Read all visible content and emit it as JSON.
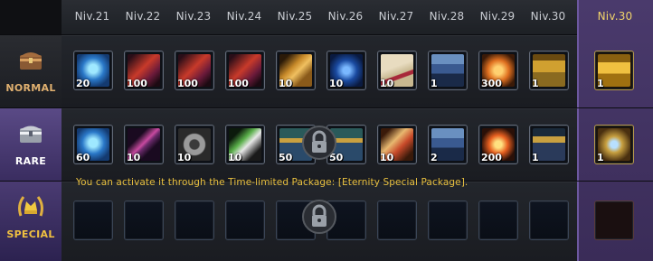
{
  "header": {
    "levels": [
      "Niv.21",
      "Niv.22",
      "Niv.23",
      "Niv.24",
      "Niv.25",
      "Niv.26",
      "Niv.27",
      "Niv.28",
      "Niv.29",
      "Niv.30"
    ],
    "final_level": "Niv.30"
  },
  "rows": {
    "normal": {
      "label": "NORMAL",
      "quantities": [
        "20",
        "100",
        "100",
        "100",
        "10",
        "10",
        "10",
        "1",
        "300",
        "1"
      ],
      "final_quantity": "1"
    },
    "rare": {
      "label": "RARE",
      "quantities": [
        "60",
        "10",
        "10",
        "10",
        "50",
        "50",
        "10",
        "2",
        "200",
        "1"
      ],
      "final_quantity": "1"
    },
    "special": {
      "label": "SPECIAL",
      "notice": "You can activate it through the Time-limited Package: [Eternity Special Package]."
    }
  },
  "icons": {
    "normal": [
      "blue-gem-icon",
      "red-feather-icon",
      "red-feather-icon",
      "red-feather-icon",
      "golden-scroll-icon",
      "blue-magic-circle-icon",
      "sealed-letter-icon",
      "silver-chest-icon",
      "orange-gem-icon",
      "golden-chest-icon"
    ],
    "rare": [
      "blue-gem-icon",
      "magic-staff-icon",
      "gears-icon",
      "green-capsule-icon",
      "ornate-capsule-icon",
      "ornate-capsule-icon",
      "parchment-scroll-icon",
      "silver-chest-icon",
      "fire-orb-icon",
      "ornate-chest-icon"
    ],
    "final_normal": "golden-treasure-chest-icon",
    "final_rare": "jeweled-chest-icon",
    "row_normal": "chest-icon",
    "row_rare": "silver-box-icon",
    "row_special": "crown-laurel-icon"
  },
  "colors": {
    "accent": "#f0c040",
    "final_column": "#4a3a6c"
  }
}
